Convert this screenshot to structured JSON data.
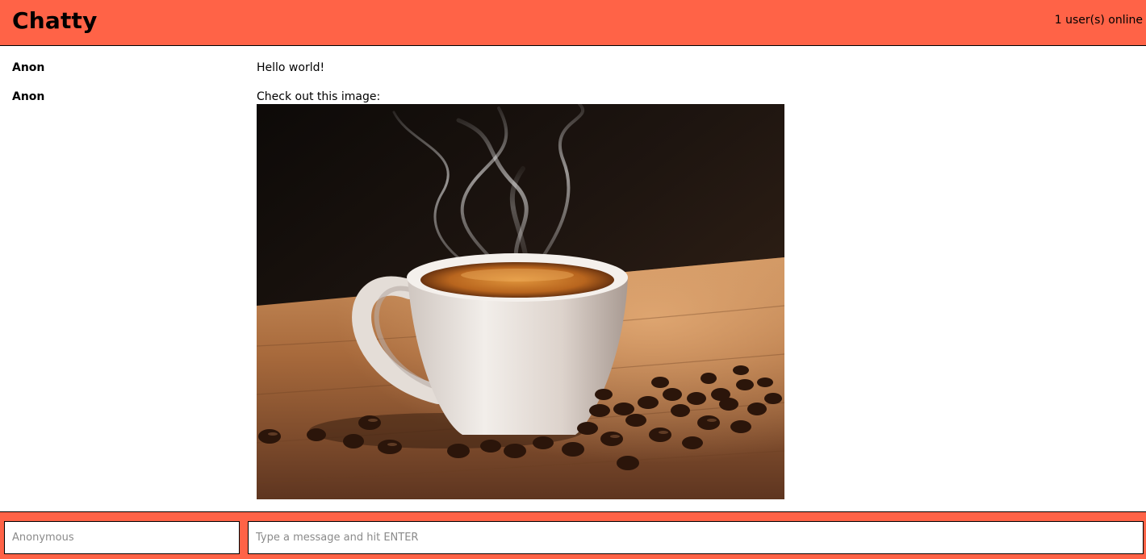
{
  "navbar": {
    "brand": "Chatty",
    "online_count": "1 user(s) online"
  },
  "messages": [
    {
      "username": "Anon",
      "content": "Hello world!"
    },
    {
      "username": "Anon",
      "content": "Check out this image:",
      "image": "coffee-cup-with-steam-and-coffee-beans"
    }
  ],
  "chatbar": {
    "username_placeholder": "Anonymous",
    "message_placeholder": "Type a message and hit ENTER"
  },
  "colors": {
    "accent": "#ff6347",
    "border": "#000000"
  }
}
